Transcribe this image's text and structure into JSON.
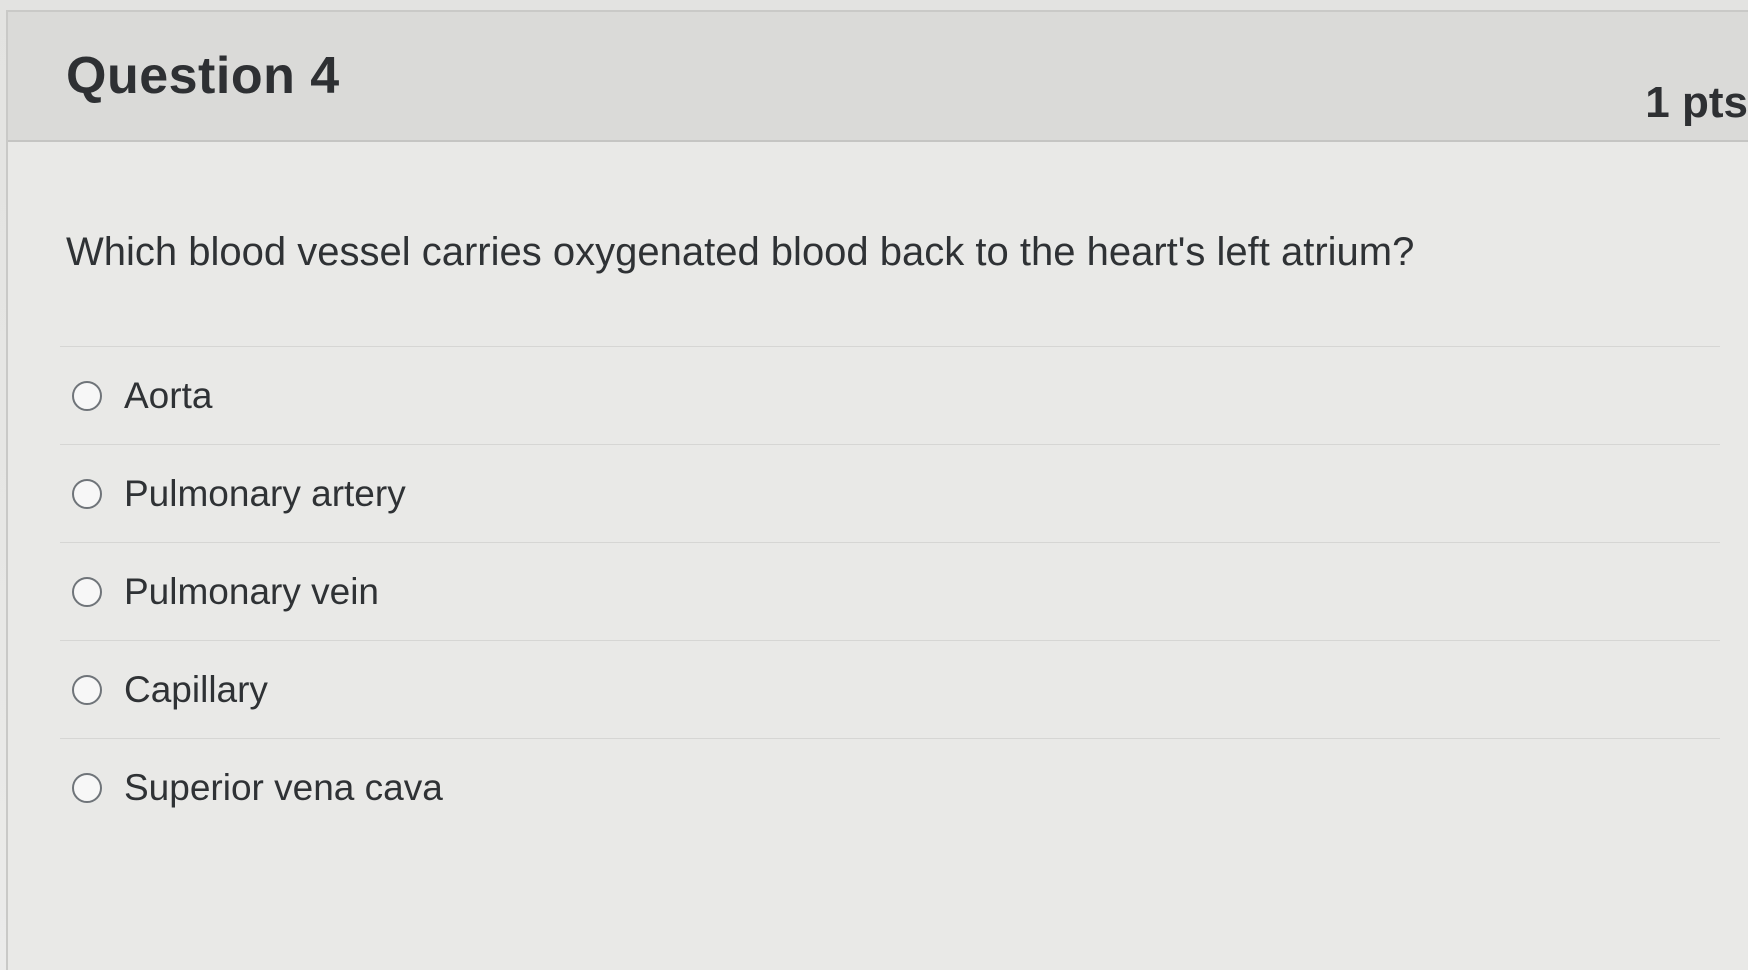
{
  "question": {
    "title": "Question 4",
    "points": "1 pts",
    "text": "Which blood vessel carries oxygenated blood back to the heart's left atrium?",
    "answers": [
      {
        "label": "Aorta",
        "selected": false
      },
      {
        "label": "Pulmonary artery",
        "selected": false
      },
      {
        "label": "Pulmonary vein",
        "selected": false
      },
      {
        "label": "Capillary",
        "selected": false
      },
      {
        "label": "Superior vena cava",
        "selected": false
      }
    ]
  }
}
